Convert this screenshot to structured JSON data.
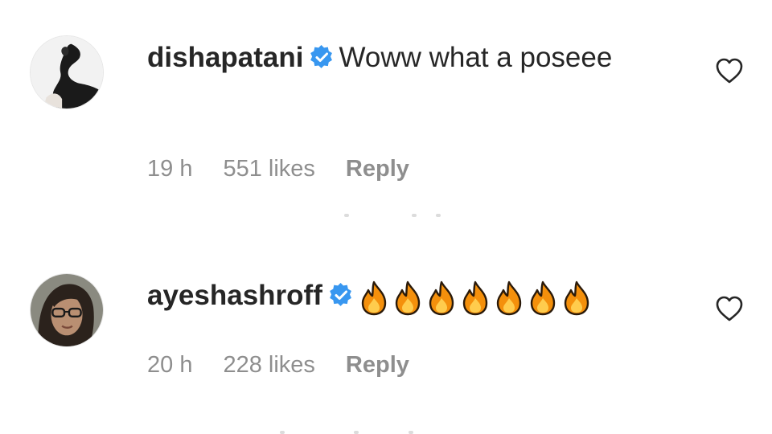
{
  "comments": [
    {
      "username": "dishapatani",
      "verified": true,
      "text": "Woww what a poseee",
      "time": "19 h",
      "likes": "551 likes",
      "reply": "Reply",
      "avatar_icon": "user-avatar",
      "like_icon": "heart-outline-icon"
    },
    {
      "username": "ayeshashroff",
      "verified": true,
      "emoji": "🔥🔥🔥🔥🔥🔥🔥",
      "time": "20 h",
      "likes": "228 likes",
      "reply": "Reply",
      "avatar_icon": "user-avatar",
      "like_icon": "heart-outline-icon"
    }
  ],
  "colors": {
    "text": "#262626",
    "meta": "#8e8e8e",
    "verified_badge": "#3897f0",
    "flame_outer": "#f4900c",
    "flame_inner": "#ffcc4d",
    "flame_outline": "#2a1a0a"
  }
}
